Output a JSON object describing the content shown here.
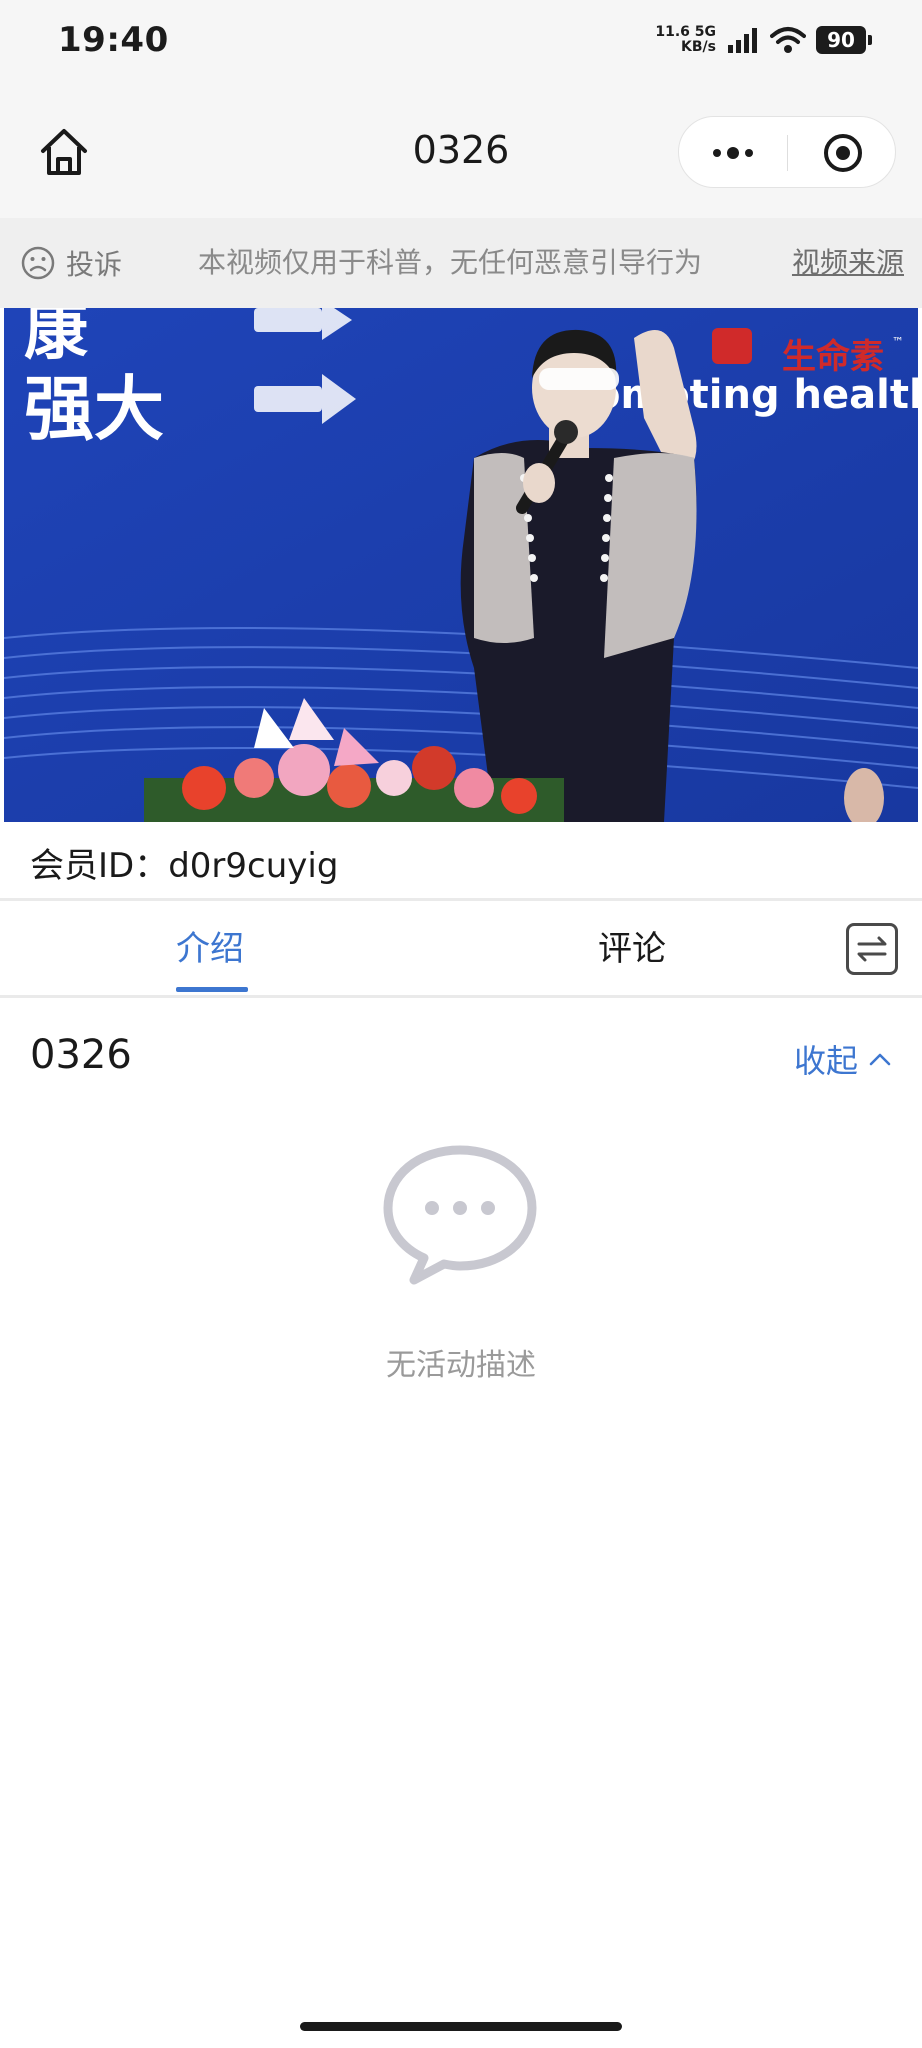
{
  "status_bar": {
    "time": "19:40",
    "speed_value": "11.6",
    "speed_unit": "KB/s",
    "network": "5G",
    "battery": "90"
  },
  "nav": {
    "title": "0326",
    "home_icon": "home-icon",
    "more_icon": "more-dots-icon",
    "close_icon": "target-close-icon"
  },
  "notice": {
    "complaint_label": "投诉",
    "message": "本视频仅用于科普，无任何恶意引导行为",
    "source_link": "视频来源"
  },
  "video": {
    "banner_text_1": "康",
    "banner_text_2": "强大",
    "banner_english": "Promoting health",
    "brand_name": "生命素",
    "brand_tm": "™"
  },
  "member": {
    "label": "会员ID：",
    "id": "d0r9cuyig"
  },
  "tabs": {
    "intro": "介绍",
    "comments": "评论",
    "active": "intro",
    "accent_color": "#3d76d0"
  },
  "content": {
    "title": "0326",
    "collapse_label": "收起",
    "empty_text": "无活动描述"
  }
}
